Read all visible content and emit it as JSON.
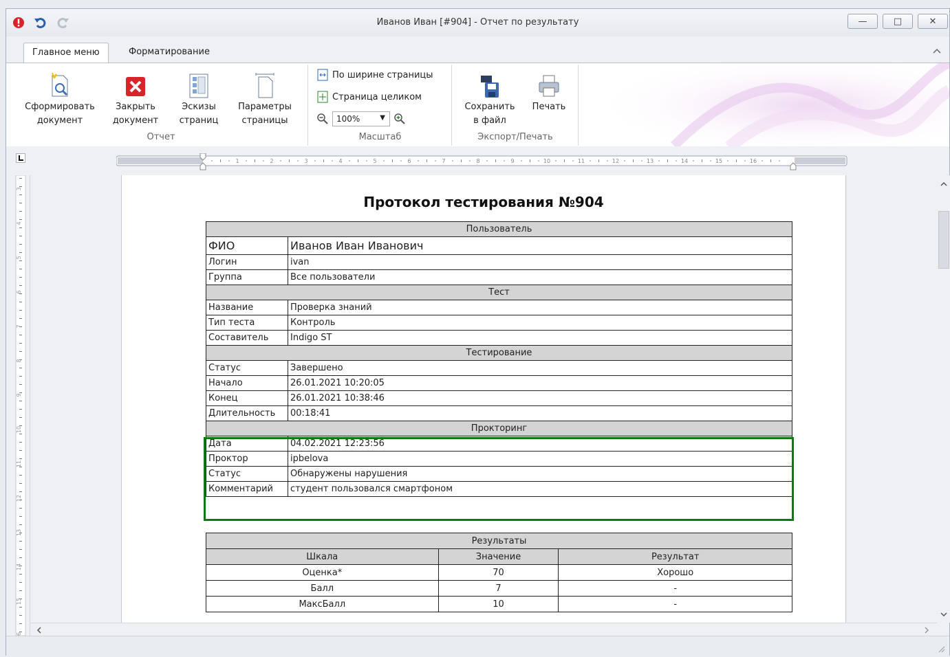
{
  "window": {
    "title": "Иванов Иван [#904] - Отчет по результату"
  },
  "ribbon_tabs": [
    "Главное меню",
    "Форматирование"
  ],
  "ribbon": {
    "groups": {
      "report": {
        "label": "Отчет",
        "generate": "Сформировать\nдокумент",
        "close": "Закрыть\nдокумент",
        "thumbnails": "Эскизы\nстраниц",
        "page_setup": "Параметры\nстраницы"
      },
      "zoom": {
        "label": "Масштаб",
        "page_width": "По ширине страницы",
        "whole_page": "Страница целиком",
        "zoom_value": "100%"
      },
      "export": {
        "label": "Экспорт/Печать",
        "save": "Сохранить\nв файл",
        "print": "Печать"
      }
    }
  },
  "ruler_marks": [
    "1",
    "2",
    "3",
    "4",
    "5",
    "6",
    "7",
    "8",
    "9",
    "10",
    "11",
    "12",
    "13",
    "14",
    "15",
    "16"
  ],
  "vruler_marks": [
    "3",
    "4",
    "5",
    "6",
    "7",
    "8",
    "9",
    "10",
    "11",
    "12",
    "13",
    "14",
    "15",
    "16"
  ],
  "document": {
    "title": "Протокол тестирования №904",
    "sections": {
      "user": {
        "header": "Пользователь",
        "rows": [
          {
            "key": "ФИО",
            "value": "Иванов Иван Иванович"
          },
          {
            "key": "Логин",
            "value": "ivan"
          },
          {
            "key": "Группа",
            "value": "Все пользователи"
          }
        ]
      },
      "test": {
        "header": "Тест",
        "rows": [
          {
            "key": "Название",
            "value": "Проверка знаний"
          },
          {
            "key": "Тип теста",
            "value": "Контроль"
          },
          {
            "key": "Составитель",
            "value": "Indigo ST"
          }
        ]
      },
      "testing": {
        "header": "Тестирование",
        "rows": [
          {
            "key": "Статус",
            "value": "Завершено"
          },
          {
            "key": "Начало",
            "value": "26.01.2021 10:20:05"
          },
          {
            "key": "Конец",
            "value": "26.01.2021 10:38:46"
          },
          {
            "key": "Длительность",
            "value": "00:18:41"
          }
        ]
      },
      "proctoring": {
        "header": "Прокторинг",
        "rows": [
          {
            "key": "Дата",
            "value": "04.02.2021 12:23:56"
          },
          {
            "key": "Проктор",
            "value": "ipbelova"
          },
          {
            "key": "Статус",
            "value": "Обнаружены нарушения"
          },
          {
            "key": "Комментарий",
            "value": "студент пользовался смартфоном"
          }
        ],
        "highlight_color": "#0a7a12"
      }
    },
    "results": {
      "header": "Результаты",
      "columns": [
        "Шкала",
        "Значение",
        "Результат"
      ],
      "rows": [
        [
          "Оценка*",
          "70",
          "Хорошо"
        ],
        [
          "Балл",
          "7",
          "-"
        ],
        [
          "МаксБалл",
          "10",
          "-"
        ]
      ]
    }
  }
}
